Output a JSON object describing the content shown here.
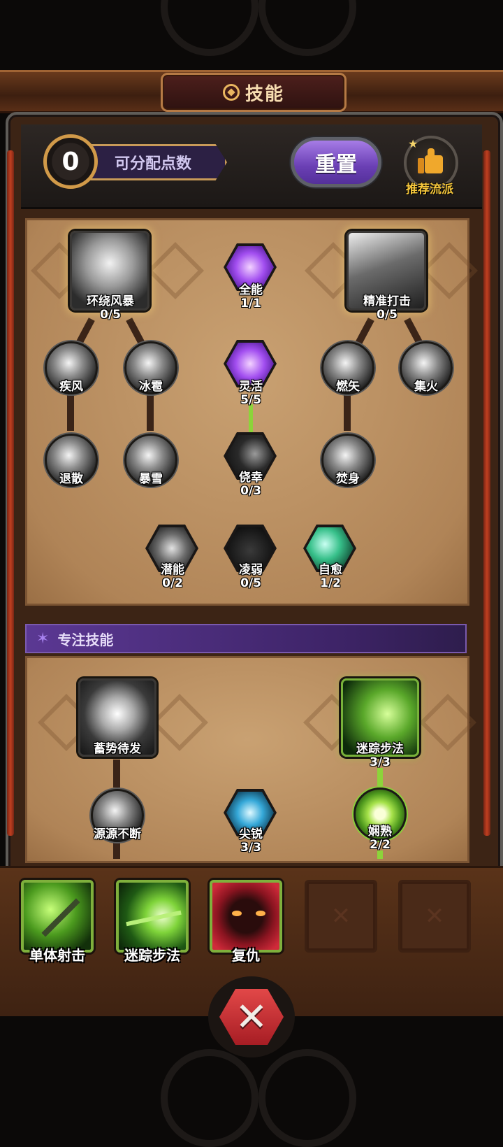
{
  "header": {
    "title": "技能"
  },
  "points": {
    "value": "0",
    "label": "可分配点数"
  },
  "buttons": {
    "reset": "重置",
    "recommend": "推荐流派"
  },
  "tree": {
    "nodes": [
      {
        "id": "huanrao",
        "name": "环绕风暴",
        "level": "0/5",
        "shape": "square"
      },
      {
        "id": "quanneng",
        "name": "全能",
        "level": "1/1",
        "shape": "hex"
      },
      {
        "id": "jingzhun",
        "name": "精准打击",
        "level": "0/5",
        "shape": "square"
      },
      {
        "id": "jifeng",
        "name": "疾风",
        "level": "",
        "shape": "round"
      },
      {
        "id": "bingbao",
        "name": "冰雹",
        "level": "",
        "shape": "round"
      },
      {
        "id": "linghuo",
        "name": "灵活",
        "level": "5/5",
        "shape": "hex"
      },
      {
        "id": "ranshi",
        "name": "燃矢",
        "level": "",
        "shape": "round"
      },
      {
        "id": "jihuo",
        "name": "集火",
        "level": "",
        "shape": "round"
      },
      {
        "id": "tuisan",
        "name": "退散",
        "level": "",
        "shape": "round"
      },
      {
        "id": "baoxue",
        "name": "暴雪",
        "level": "",
        "shape": "round"
      },
      {
        "id": "jiaoxing",
        "name": "侥幸",
        "level": "0/3",
        "shape": "hex"
      },
      {
        "id": "fenshen",
        "name": "焚身",
        "level": "",
        "shape": "round"
      },
      {
        "id": "qianneng",
        "name": "潜能",
        "level": "0/2",
        "shape": "hex"
      },
      {
        "id": "lingruo",
        "name": "凌弱",
        "level": "0/5",
        "shape": "hex"
      },
      {
        "id": "ziyu",
        "name": "自愈",
        "level": "1/2",
        "shape": "hex"
      }
    ]
  },
  "focus": {
    "title": "专注技能",
    "nodes": [
      {
        "id": "xushi",
        "name": "蓄势待发",
        "level": "",
        "shape": "square"
      },
      {
        "id": "mizong",
        "name": "迷踪步法",
        "level": "3/3",
        "shape": "square"
      },
      {
        "id": "yuanyuan",
        "name": "源源不断",
        "level": "",
        "shape": "round"
      },
      {
        "id": "jianrui",
        "name": "尖锐",
        "level": "3/3",
        "shape": "hex"
      },
      {
        "id": "xianshu",
        "name": "娴熟",
        "level": "2/2",
        "shape": "round"
      }
    ]
  },
  "slots": [
    {
      "label": "单体射击",
      "icon": "spear-icon"
    },
    {
      "label": "迷踪步法",
      "icon": "dash-icon"
    },
    {
      "label": "复仇",
      "icon": "demon-eyes-icon"
    },
    {
      "label": "",
      "icon": "empty-slot"
    },
    {
      "label": "",
      "icon": "empty-slot"
    }
  ],
  "colors": {
    "accent_purple": "#7a4fd0",
    "active_green": "#8cd43a",
    "parchment": "#c19466",
    "close_red": "#d23a3e"
  }
}
